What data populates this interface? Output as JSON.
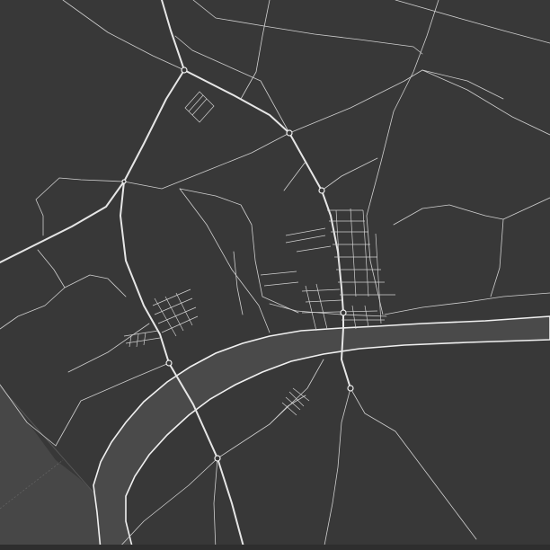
{
  "map": {
    "theme": "dark",
    "colors": {
      "background": "#383838",
      "water": "#4a4a4a",
      "sea": "#474747",
      "road": "#e6e6e6",
      "minor_road": "#cfcfcf",
      "river_bank": "#f0f0f0",
      "label": "#9a9a9a"
    },
    "features": [
      "river",
      "sea",
      "roads",
      "town-grid",
      "road-junctions"
    ]
  }
}
